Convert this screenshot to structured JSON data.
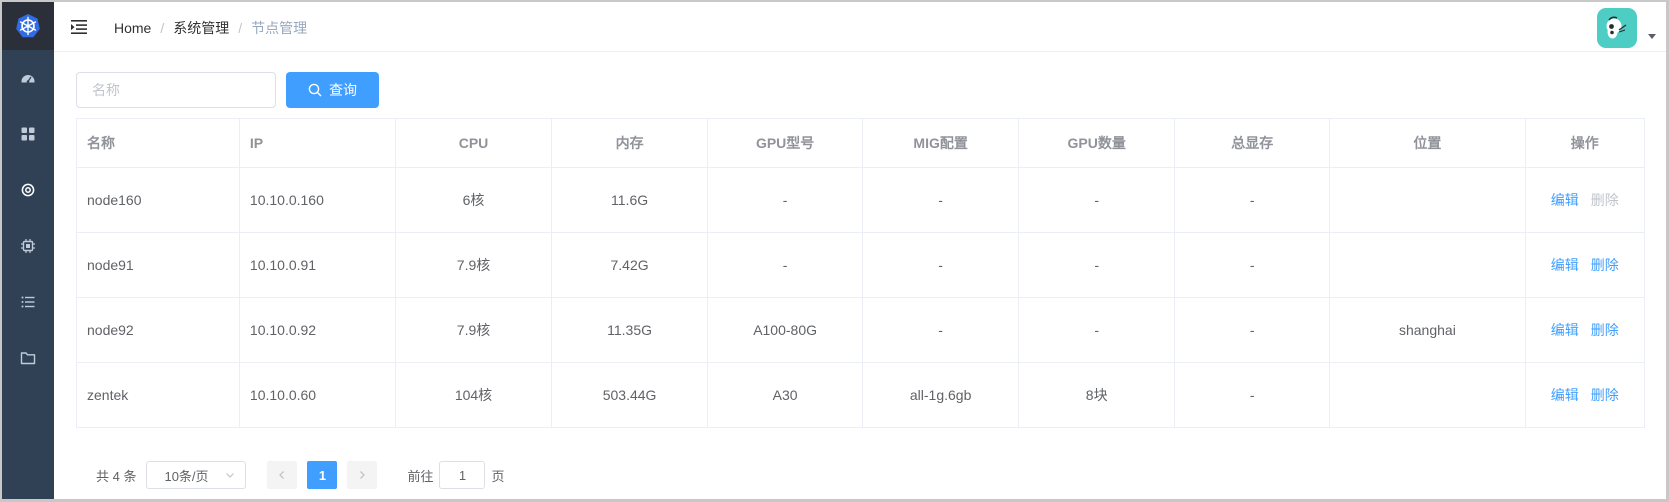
{
  "breadcrumb": {
    "home": "Home",
    "section": "系统管理",
    "current": "节点管理",
    "separator": "/"
  },
  "search": {
    "placeholder": "名称",
    "value": "",
    "button_label": "查询"
  },
  "sidebar": {
    "items": [
      {
        "icon": "dashboard-icon"
      },
      {
        "icon": "grid-icon"
      },
      {
        "icon": "gear-icon",
        "active": true
      },
      {
        "icon": "chip-icon"
      },
      {
        "icon": "list-icon"
      },
      {
        "icon": "folder-icon"
      }
    ]
  },
  "table": {
    "columns": [
      "名称",
      "IP",
      "CPU",
      "内存",
      "GPU型号",
      "MIG配置",
      "GPU数量",
      "总显存",
      "位置",
      "操作"
    ],
    "rows": [
      {
        "name": "node160",
        "ip": "10.10.0.160",
        "cpu": "6核",
        "memory": "11.6G",
        "gpu_model": "-",
        "mig": "-",
        "gpu_count": "-",
        "vram": "-",
        "location": "",
        "delete_disabled": true
      },
      {
        "name": "node91",
        "ip": "10.10.0.91",
        "cpu": "7.9核",
        "memory": "7.42G",
        "gpu_model": "-",
        "mig": "-",
        "gpu_count": "-",
        "vram": "-",
        "location": "",
        "delete_disabled": false
      },
      {
        "name": "node92",
        "ip": "10.10.0.92",
        "cpu": "7.9核",
        "memory": "11.35G",
        "gpu_model": "A100-80G",
        "mig": "-",
        "gpu_count": "-",
        "vram": "-",
        "location": "shanghai",
        "delete_disabled": false
      },
      {
        "name": "zentek",
        "ip": "10.10.0.60",
        "cpu": "104核",
        "memory": "503.44G",
        "gpu_model": "A30",
        "mig": "all-1g.6gb",
        "gpu_count": "8块",
        "vram": "-",
        "location": "",
        "delete_disabled": false
      }
    ],
    "edit_label": "编辑",
    "delete_label": "删除"
  },
  "pagination": {
    "total_text": "共 4 条",
    "page_size": "10条/页",
    "current_page": "1",
    "goto_prefix": "前往",
    "goto_value": "1",
    "goto_suffix": "页"
  },
  "colors": {
    "sidebar_bg": "#304156",
    "primary": "#409eff",
    "avatar_bg": "#4ecdc4"
  }
}
